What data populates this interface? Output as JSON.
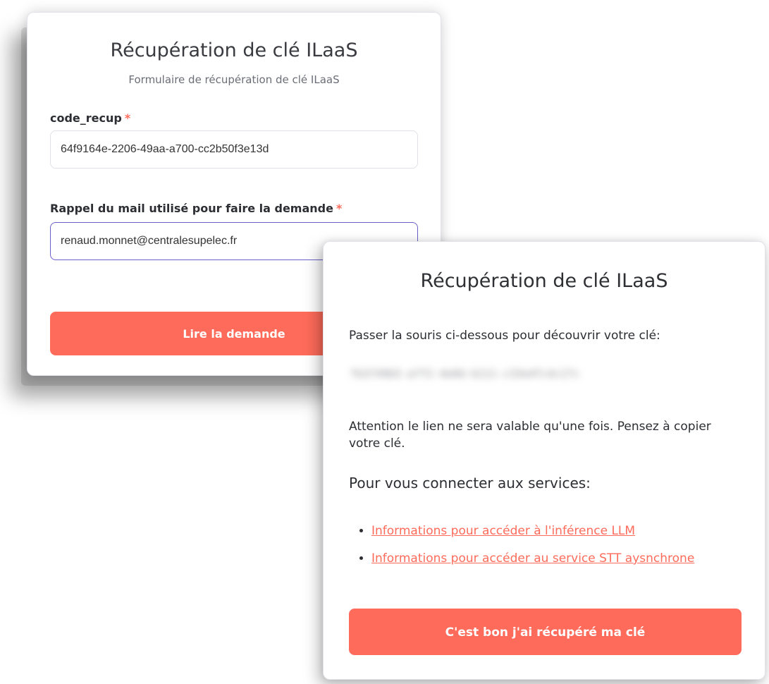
{
  "form_card": {
    "title": "Récupération de clé ILaaS",
    "subtitle": "Formulaire de récupération de clé ILaaS",
    "fields": [
      {
        "label": "code_recup",
        "required_marker": "*",
        "value": "64f9164e-2206-49aa-a700-cc2b50f3e13d"
      },
      {
        "label": "Rappel du mail utilisé pour faire la demande",
        "required_marker": "*",
        "value": "renaud.monnet@centralesupelec.fr"
      }
    ],
    "submit_label": "Lire la demande"
  },
  "result_card": {
    "title": "Récupération de clé ILaaS",
    "hover_hint": "Passer la souris ci-dessous pour découvrir votre clé:",
    "key_hidden": "fb3749b5-a7f2-4e0d-b111-c33e4fc4c17c",
    "warning": "Attention le lien ne sera valable qu'une fois. Pensez à copier votre clé.",
    "services_title": "Pour vous connecter aux services:",
    "links": [
      "Informations pour accéder à l'inférence LLM",
      "Informations pour accéder au service STT aysnchrone"
    ],
    "confirm_label": "C'est bon j'ai récupéré ma clé"
  },
  "colors": {
    "accent": "#ff6b5a",
    "focus_border": "#6a5fc9"
  }
}
